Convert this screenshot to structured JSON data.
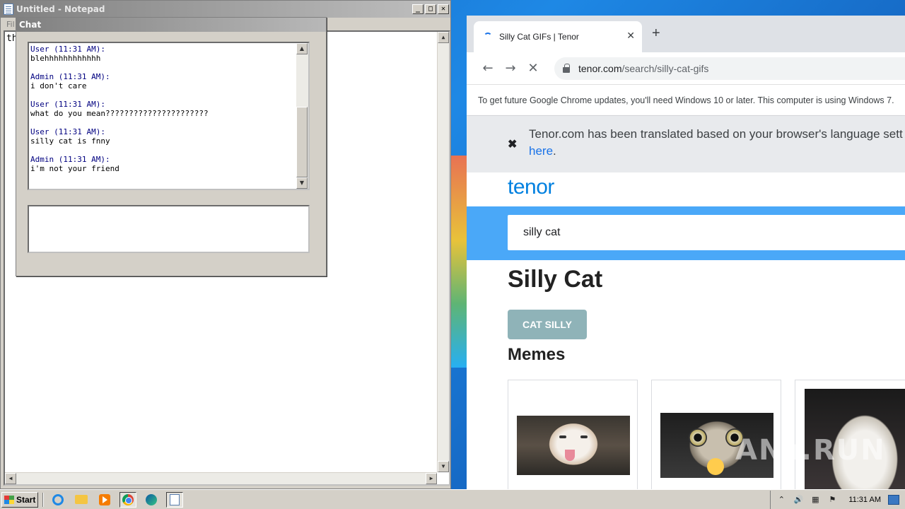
{
  "notepad": {
    "title": "Untitled - Notepad",
    "menu_partial": "Fil",
    "editor_text": "th",
    "buttons": {
      "minimize": "_",
      "maximize": "□",
      "close": "✕"
    }
  },
  "chat": {
    "title": "Chat",
    "messages": [
      {
        "header": "User (11:31 AM):",
        "body": "blehhhhhhhhhhhh"
      },
      {
        "header": "Admin (11:31 AM):",
        "body": "i don't care"
      },
      {
        "header": "User (11:31 AM):",
        "body": "what do you mean??????????????????????"
      },
      {
        "header": "User (11:31 AM):",
        "body": "silly cat is fnny"
      },
      {
        "header": "Admin (11:31 AM):",
        "body": "i'm not your friend"
      }
    ],
    "input_value": ""
  },
  "browser": {
    "tab_title": "Silly Cat GIFs | Tenor",
    "tab_close": "✕",
    "new_tab": "+",
    "url_host": "tenor.com",
    "url_path": "/search/silly-cat-gifs",
    "nav": {
      "back": "←",
      "forward": "→",
      "stop": "✕"
    },
    "infobar_text": "To get future Google Chrome updates, you'll need Windows 10 or later. This computer is using Windows 7.",
    "translate_close": "✖",
    "translate_text": "Tenor.com has been translated based on your browser's language sett",
    "translate_link": "here",
    "translate_suffix": "."
  },
  "tenor": {
    "logo": "tenor",
    "search_value": "silly cat",
    "page_title": "Silly Cat",
    "tag_chip": "CAT SILLY",
    "section_title": "Memes",
    "watermark": "ANY.RUN"
  },
  "taskbar": {
    "start_label": "Start",
    "clock": "11:31 AM",
    "icons": [
      "ie-icon",
      "explorer-icon",
      "media-player-icon",
      "chrome-icon",
      "edge-icon",
      "notepad-icon"
    ]
  }
}
